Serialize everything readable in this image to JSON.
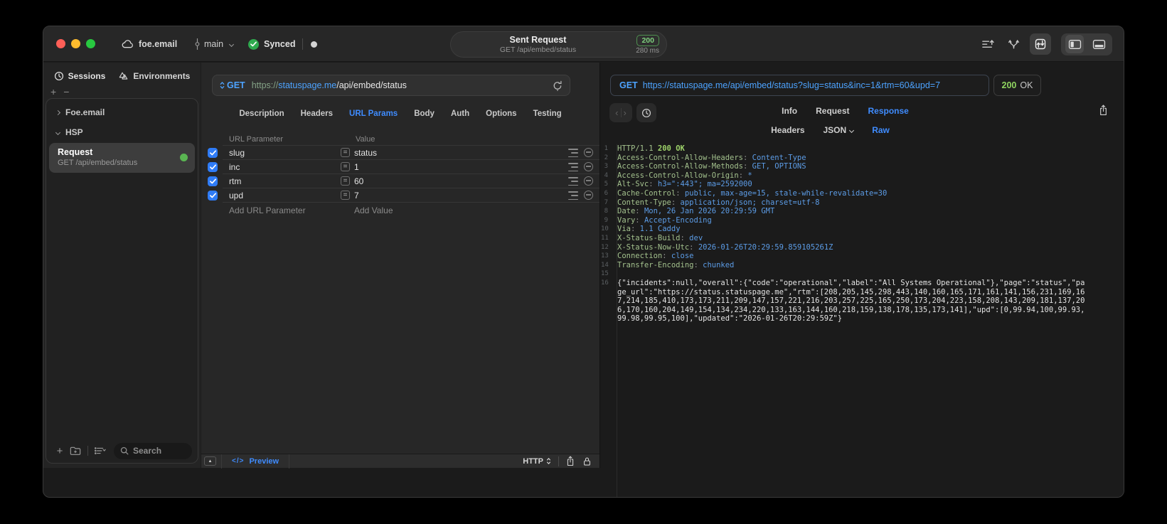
{
  "titlebar": {
    "project_name": "foe.email",
    "branch_name": "main",
    "sync_label": "Synced",
    "request_summary": {
      "title": "Sent Request",
      "subtitle": "GET /api/embed/status",
      "status_code": "200",
      "duration": "280 ms"
    }
  },
  "sidebar": {
    "tab_sessions": "Sessions",
    "tab_environments": "Environments",
    "group_item": "Foe.email",
    "folder_item": "HSP",
    "request_item": {
      "title": "Request",
      "subtitle": "GET /api/embed/status"
    },
    "search_placeholder": "Search"
  },
  "request_editor": {
    "method": "GET",
    "url": {
      "scheme": "https://",
      "host": "statuspage.me",
      "path": "/api/embed/status"
    },
    "tabs": [
      "Description",
      "Headers",
      "URL Params",
      "Body",
      "Auth",
      "Options",
      "Testing"
    ],
    "active_tab": "URL Params",
    "params": {
      "col_name": "URL Parameter",
      "col_value": "Value",
      "rows": [
        {
          "name": "slug",
          "value": "status",
          "enabled": true
        },
        {
          "name": "inc",
          "value": "1",
          "enabled": true
        },
        {
          "name": "rtm",
          "value": "60",
          "enabled": true
        },
        {
          "name": "upd",
          "value": "7",
          "enabled": true
        }
      ],
      "add_name_placeholder": "Add URL Parameter",
      "add_value_placeholder": "Add Value"
    },
    "footer": {
      "preview_icon_text": "</>",
      "preview_label": "Preview",
      "protocol_label": "HTTP"
    }
  },
  "response_viewer": {
    "method": "GET",
    "url": "https://statuspage.me/api/embed/status?slug=status&inc=1&rtm=60&upd=7",
    "status_code": "200",
    "status_text": "OK",
    "tabs": [
      "Info",
      "Request",
      "Response"
    ],
    "active_tab": "Response",
    "subtabs": [
      "Headers",
      "JSON",
      "Raw"
    ],
    "active_subtab": "Raw",
    "raw": {
      "status_line": "HTTP/1.1 200 OK",
      "headers": [
        [
          "Access-Control-Allow-Headers",
          "Content-Type"
        ],
        [
          "Access-Control-Allow-Methods",
          "GET, OPTIONS"
        ],
        [
          "Access-Control-Allow-Origin",
          "*"
        ],
        [
          "Alt-Svc",
          "h3=\":443\"; ma=2592000"
        ],
        [
          "Cache-Control",
          "public, max-age=15, stale-while-revalidate=30"
        ],
        [
          "Content-Type",
          "application/json; charset=utf-8"
        ],
        [
          "Date",
          "Mon, 26 Jan 2026 20:29:59 GMT"
        ],
        [
          "Vary",
          "Accept-Encoding"
        ],
        [
          "Via",
          "1.1 Caddy"
        ],
        [
          "X-Status-Build",
          "dev"
        ],
        [
          "X-Status-Now-Utc",
          "2026-01-26T20:29:59.859105261Z"
        ],
        [
          "Connection",
          "close"
        ],
        [
          "Transfer-Encoding",
          "chunked"
        ]
      ],
      "body": "{\"incidents\":null,\"overall\":{\"code\":\"operational\",\"label\":\"All Systems Operational\"},\"page\":\"status\",\"page_url\":\"https://status.statuspage.me\",\"rtm\":[208,205,145,298,443,140,160,165,171,161,141,156,231,169,167,214,185,410,173,173,211,209,147,157,221,216,203,257,225,165,250,173,204,223,158,208,143,209,181,137,206,170,160,204,149,154,134,234,220,133,163,144,160,218,159,138,178,135,173,141],\"upd\":[0,99.94,100,99.93,99.98,99.95,100],\"updated\":\"2026-01-26T20:29:59Z\"}"
    }
  },
  "colors": {
    "accent_blue": "#3f8cff",
    "header_green": "#a3c18d",
    "value_blue": "#5c9ce6",
    "status_green": "#7ed07e",
    "checkbox_blue": "#2f7cf7",
    "traffic_red": "#ff5f57",
    "traffic_yellow": "#febc2e",
    "traffic_green": "#28c840"
  }
}
